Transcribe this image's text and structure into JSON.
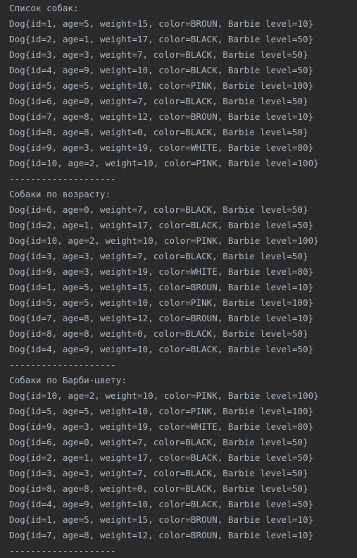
{
  "console": {
    "sections": [
      {
        "title": "Список собак:",
        "lines": [
          "Dog{id=1, age=5, weight=15, color=BROUN, Barbie level=10}",
          "Dog{id=2, age=1, weight=17, color=BLACK, Barbie level=50}",
          "Dog{id=3, age=3, weight=7, color=BLACK, Barbie level=50}",
          "Dog{id=4, age=9, weight=10, color=BLACK, Barbie level=50}",
          "Dog{id=5, age=5, weight=10, color=PINK, Barbie level=100}",
          "Dog{id=6, age=0, weight=7, color=BLACK, Barbie level=50}",
          "Dog{id=7, age=8, weight=12, color=BROUN, Barbie level=10}",
          "Dog{id=8, age=8, weight=0, color=BLACK, Barbie level=50}",
          "Dog{id=9, age=3, weight=19, color=WHITE, Barbie level=80}",
          "Dog{id=10, age=2, weight=10, color=PINK, Barbie level=100}"
        ],
        "separator": "--------------------"
      },
      {
        "title": "Собаки по возрасту:",
        "lines": [
          "Dog{id=6, age=0, weight=7, color=BLACK, Barbie level=50}",
          "Dog{id=2, age=1, weight=17, color=BLACK, Barbie level=50}",
          "Dog{id=10, age=2, weight=10, color=PINK, Barbie level=100}",
          "Dog{id=3, age=3, weight=7, color=BLACK, Barbie level=50}",
          "Dog{id=9, age=3, weight=19, color=WHITE, Barbie level=80}",
          "Dog{id=1, age=5, weight=15, color=BROUN, Barbie level=10}",
          "Dog{id=5, age=5, weight=10, color=PINK, Barbie level=100}",
          "Dog{id=7, age=8, weight=12, color=BROUN, Barbie level=10}",
          "Dog{id=8, age=8, weight=0, color=BLACK, Barbie level=50}",
          "Dog{id=4, age=9, weight=10, color=BLACK, Barbie level=50}"
        ],
        "separator": "--------------------"
      },
      {
        "title": "Собаки по Барби-цвету:",
        "lines": [
          "Dog{id=10, age=2, weight=10, color=PINK, Barbie level=100}",
          "Dog{id=5, age=5, weight=10, color=PINK, Barbie level=100}",
          "Dog{id=9, age=3, weight=19, color=WHITE, Barbie level=80}",
          "Dog{id=6, age=0, weight=7, color=BLACK, Barbie level=50}",
          "Dog{id=2, age=1, weight=17, color=BLACK, Barbie level=50}",
          "Dog{id=3, age=3, weight=7, color=BLACK, Barbie level=50}",
          "Dog{id=8, age=8, weight=0, color=BLACK, Barbie level=50}",
          "Dog{id=4, age=9, weight=10, color=BLACK, Barbie level=50}",
          "Dog{id=1, age=5, weight=15, color=BROUN, Barbie level=10}",
          "Dog{id=7, age=8, weight=12, color=BROUN, Barbie level=10}"
        ],
        "separator": "--------------------"
      }
    ]
  },
  "theme": {
    "background": "#2b2b2b",
    "text": "#a9b7c6"
  }
}
